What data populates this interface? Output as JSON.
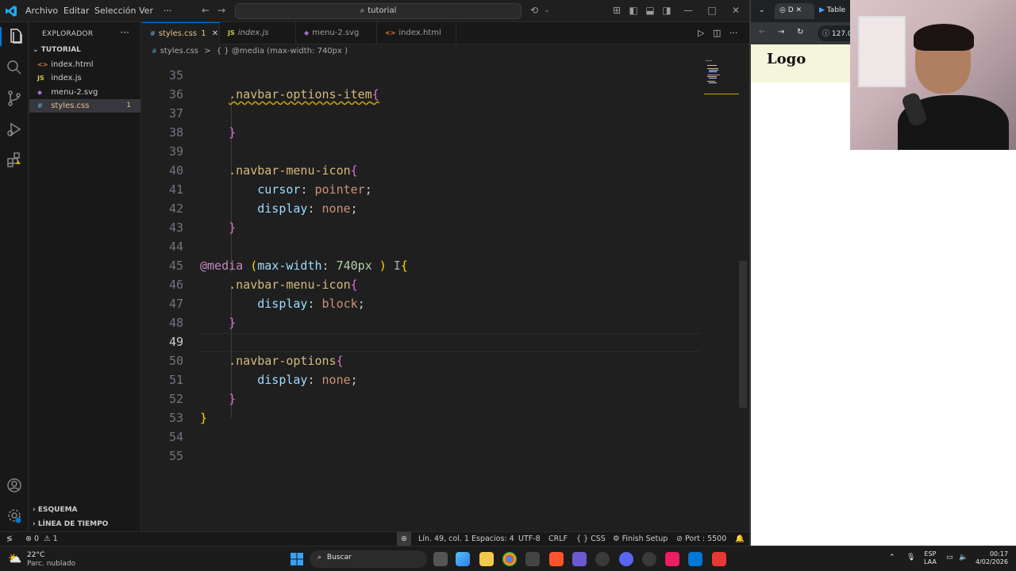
{
  "titlebar": {
    "menus": [
      "Archivo",
      "Editar",
      "Selección",
      "Ver"
    ],
    "more": "···",
    "search_text": "tutorial",
    "window_controls": {
      "minimize": "—",
      "maximize": "□",
      "close": "✕"
    }
  },
  "sidebar": {
    "title": "EXPLORADOR",
    "more": "···",
    "folder": "TUTORIAL",
    "files": [
      {
        "icon": "<>",
        "name": "index.html"
      },
      {
        "icon": "JS",
        "name": "index.js"
      },
      {
        "icon": "◆",
        "name": "menu-2.svg"
      },
      {
        "icon": "#",
        "name": "styles.css",
        "badge": "1"
      }
    ],
    "sections": [
      "ESQUEMA",
      "LÍNEA DE TIEMPO"
    ]
  },
  "tabs": [
    {
      "icon": "#",
      "label": "styles.css",
      "badge": "1",
      "close": "✕"
    },
    {
      "icon": "JS",
      "label": "index.js"
    },
    {
      "icon": "◆",
      "label": "menu-2.svg"
    },
    {
      "icon": "<>",
      "label": "index.html"
    }
  ],
  "breadcrumb": {
    "file": "styles.css",
    "sep": ">",
    "symbol": "{ } @media (max-width: 740px )"
  },
  "editor": {
    "lines": [
      {
        "n": "35"
      },
      {
        "n": "36"
      },
      {
        "n": "37"
      },
      {
        "n": "38"
      },
      {
        "n": "39"
      },
      {
        "n": "40"
      },
      {
        "n": "41"
      },
      {
        "n": "42"
      },
      {
        "n": "43"
      },
      {
        "n": "44"
      },
      {
        "n": "45"
      },
      {
        "n": "46"
      },
      {
        "n": "47"
      },
      {
        "n": "48"
      },
      {
        "n": "49"
      },
      {
        "n": "50"
      },
      {
        "n": "51"
      },
      {
        "n": "52"
      },
      {
        "n": "53"
      },
      {
        "n": "54"
      },
      {
        "n": "55"
      }
    ],
    "tokens": {
      "sel_options_item": ".navbar-options-item",
      "sel_menu_icon": ".navbar-menu-icon",
      "sel_options": ".navbar-options",
      "at_media": "@media",
      "prop_maxwidth": "max-width",
      "num_740": "740px",
      "prop_cursor": "cursor",
      "val_pointer": "pointer",
      "prop_display": "display",
      "val_none": "none",
      "val_block": "block"
    }
  },
  "statusbar": {
    "remote": "≶",
    "errors": "0",
    "warnings": "1",
    "zoom_icon": "⊕",
    "position": "Lín. 49, col. 1",
    "spaces": "Espacios: 4",
    "encoding": "UTF-8",
    "eol": "CRLF",
    "language": "CSS",
    "finish_setup": "Finish Setup",
    "port": "Port : 5500"
  },
  "browser": {
    "tab1": "D",
    "tab2": "Table",
    "url": "127.0",
    "page_logo": "Logo"
  },
  "taskbar": {
    "weather_temp": "22°C",
    "weather_desc": "Parc. nublado",
    "search": "Buscar",
    "lang_top": "ESP",
    "lang_bottom": "LAA",
    "time": "00:17",
    "date": "4/02/2026"
  },
  "colors": {
    "accent": "#0078d4",
    "selector": "#d7ba7d",
    "property": "#9cdcfe",
    "value": "#ce9178",
    "at_rule": "#c586c0",
    "warning": "#cca700"
  }
}
